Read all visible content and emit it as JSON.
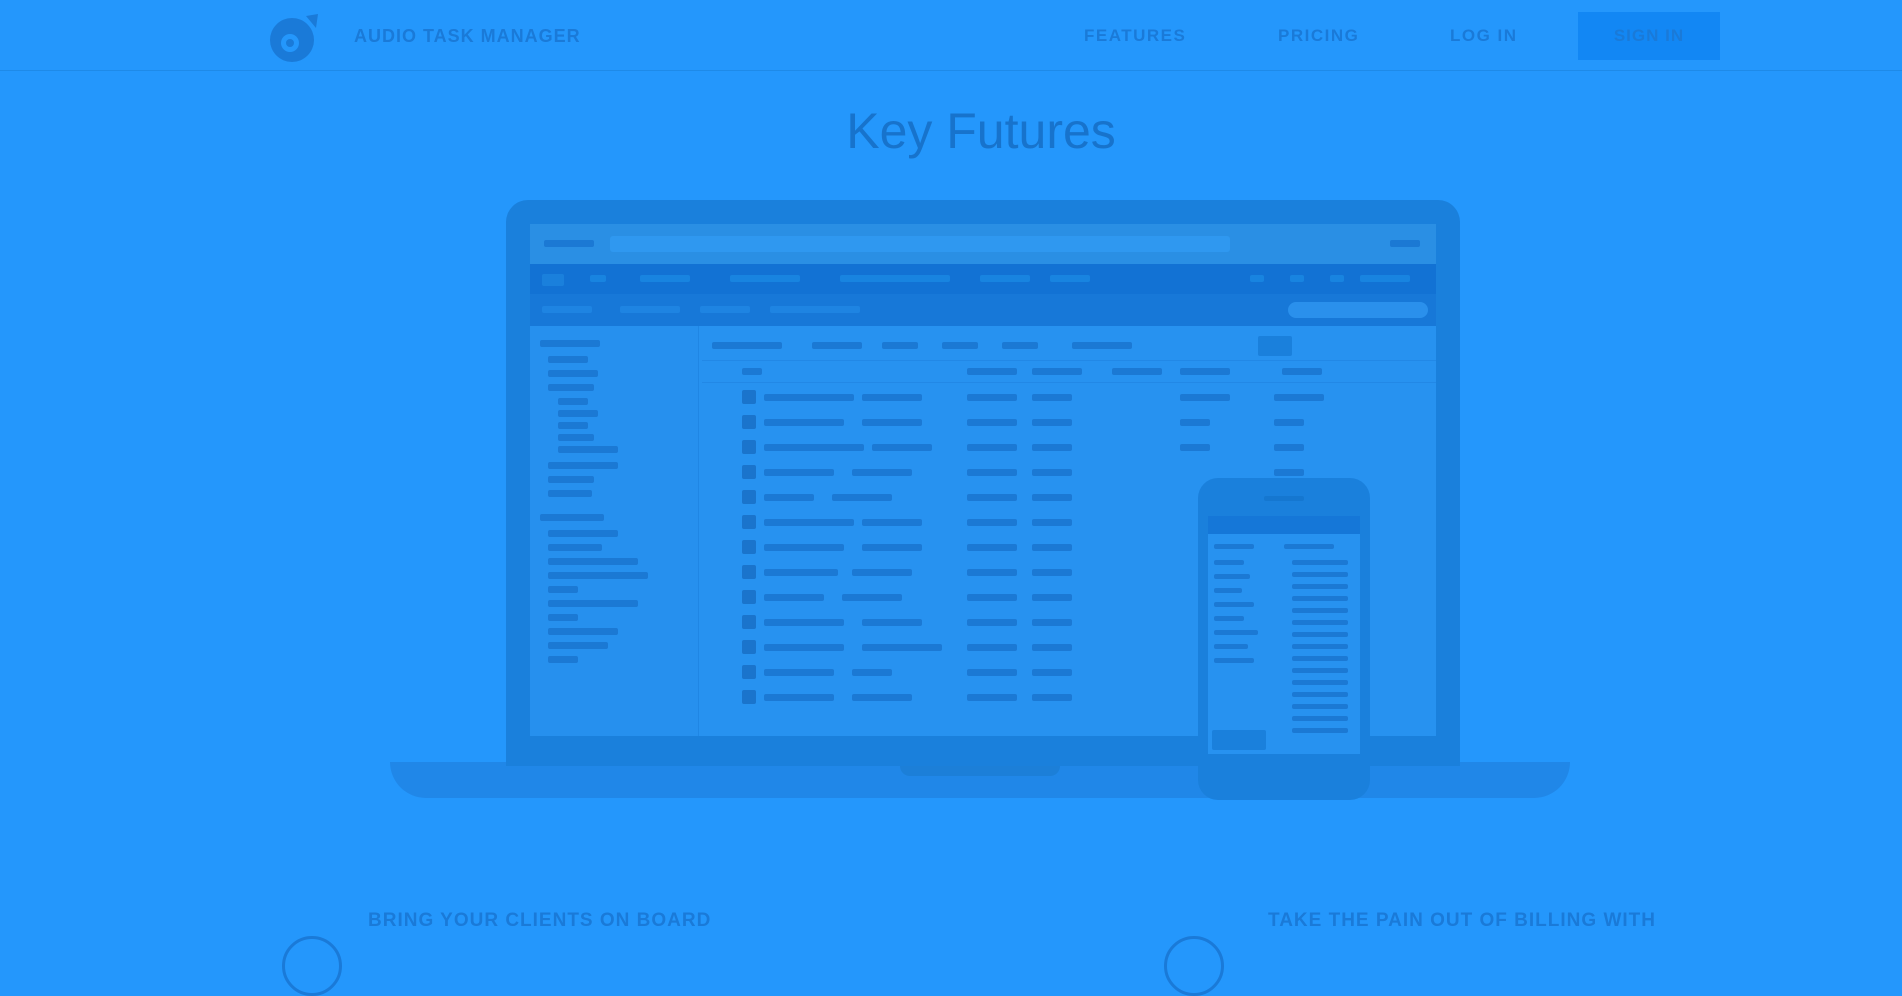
{
  "header": {
    "brand": "AUDIO TASK MANAGER",
    "nav": [
      "FEATURES",
      "PRICING",
      "LOG IN"
    ],
    "sign_in": "SIGN IN"
  },
  "hero": {
    "title": "Key Futures"
  },
  "features": [
    {
      "heading": "BRING YOUR CLIENTS ON BOARD"
    },
    {
      "heading": "TAKE THE PAIN OUT OF BILLING WITH"
    }
  ],
  "colors": {
    "background": "#2497fc",
    "accent": "#1287f4",
    "text": "#1a7ad8"
  },
  "icons": [
    "logo-icon",
    "client-icon",
    "billing-icon"
  ]
}
